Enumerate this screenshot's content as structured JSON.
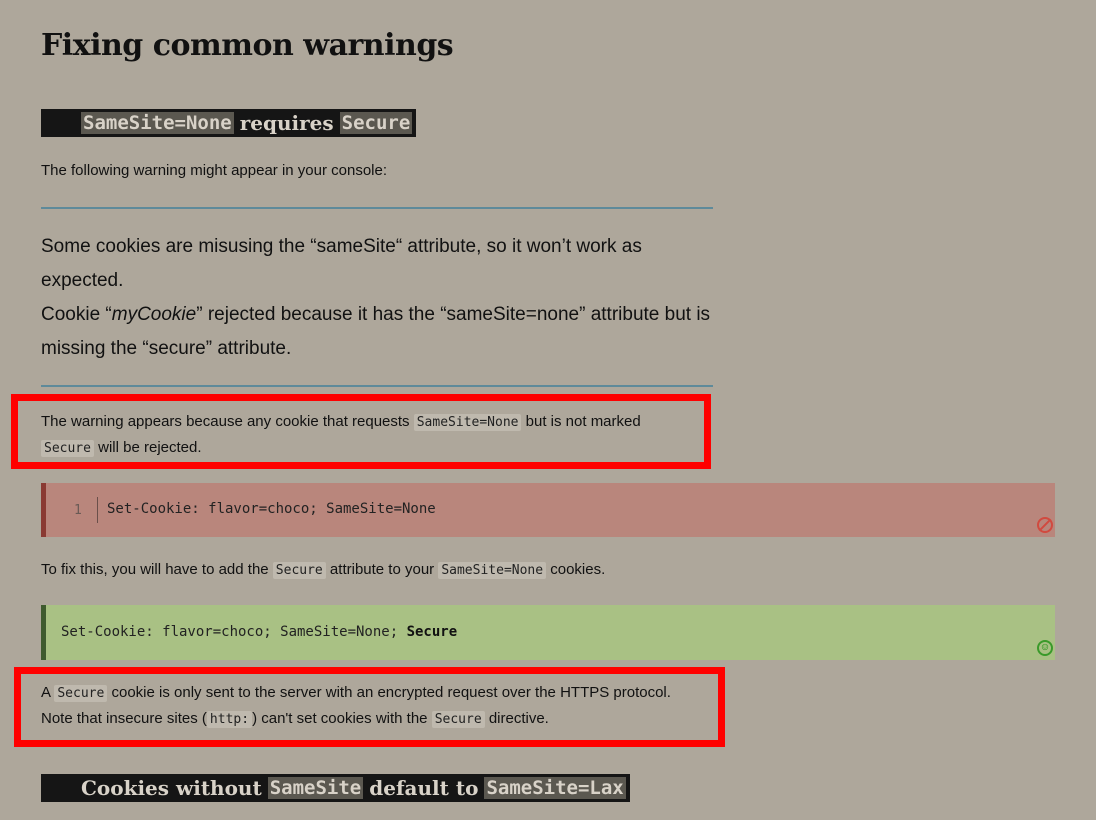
{
  "page_title": "Fixing common warnings",
  "section1": {
    "code1": "SameSite=None",
    "mid": "requires",
    "code2": "Secure"
  },
  "intro": "The following warning might appear in your console:",
  "warning": {
    "line1": "Some cookies are misusing the “sameSite“ attribute, so it won’t work as expected.",
    "line2_pre": "Cookie “",
    "line2_em": "myCookie",
    "line2_post": "” rejected because it has the “sameSite=none” attribute but is missing the “secure” attribute."
  },
  "explain": {
    "t1": "The warning appears because any cookie that requests ",
    "c1": "SameSite=None",
    "t2": " but is not marked",
    "c2": "Secure",
    "t3": " will be rejected."
  },
  "bad_code": {
    "line_number": "1",
    "text": "Set-Cookie: flavor=choco; SameSite=None",
    "badge_icon": "prohibited-icon"
  },
  "fix": {
    "t1": "To fix this, you will have to add the ",
    "c1": "Secure",
    "t2": " attribute to your ",
    "c2": "SameSite=None",
    "t3": " cookies."
  },
  "good_code": {
    "text": "Set-Cookie: flavor=choco; SameSite=None; ",
    "bold": "Secure",
    "badge_icon": "smiley-icon",
    "badge_glyph": "☺"
  },
  "secure_note": {
    "t1": "A ",
    "c1": "Secure",
    "t2": " cookie is only sent to the server with an encrypted request over the HTTPS protocol.",
    "t3": "Note that insecure sites (",
    "c2": "http:",
    "t4": ") can't set cookies with the ",
    "c3": "Secure",
    "t5": " directive."
  },
  "section2": {
    "t1": "Cookies without",
    "code1": "SameSite",
    "mid": "default to",
    "code2": "SameSite=Lax"
  },
  "colors": {
    "background": "#aea79b",
    "heading_bar": "#151515",
    "rule": "#5e8a9a",
    "bad_code_bg": "#b9867c",
    "good_code_bg": "#a9c184",
    "highlight_box": "#ff0000"
  }
}
